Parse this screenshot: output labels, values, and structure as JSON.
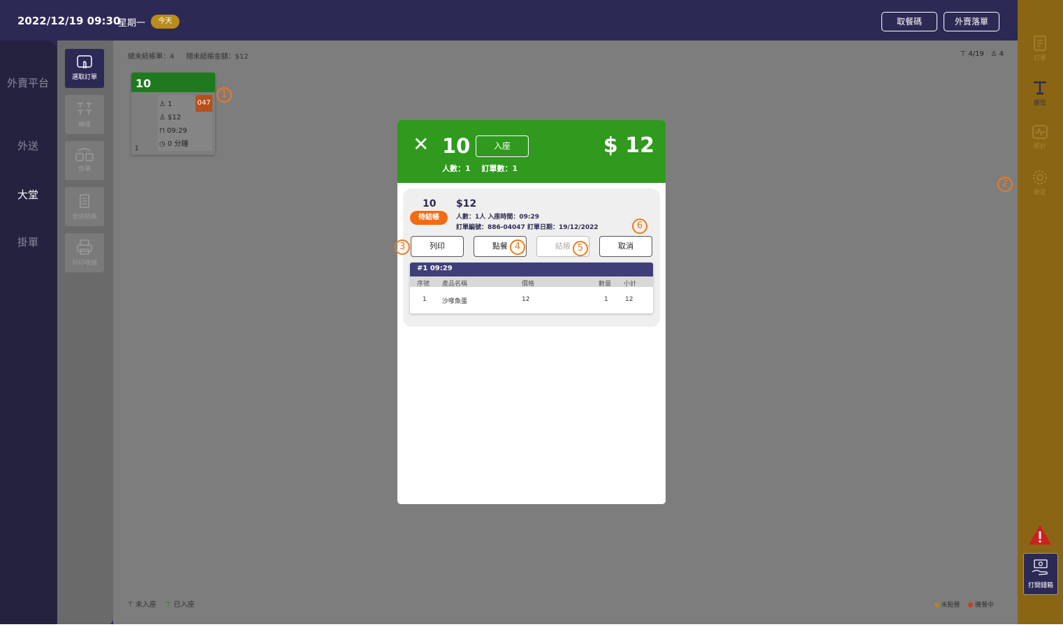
{
  "header": {
    "datetime": "2022/12/19 09:30",
    "weekday": "星期一",
    "today_badge": "今天",
    "pickup_code_button": "取餐碼",
    "takeout_order_button": "外賣落單"
  },
  "left_nav": {
    "items": [
      {
        "label": "外賣平台"
      },
      {
        "label": "外送"
      },
      {
        "label": "大堂"
      },
      {
        "label": "掛單"
      }
    ]
  },
  "tools": {
    "items": [
      {
        "label": "選取訂單",
        "icon": "touch-icon"
      },
      {
        "label": "轉檯",
        "icon": "swap-icon"
      },
      {
        "label": "併單",
        "icon": "merge-icon"
      },
      {
        "label": "合併結帳",
        "icon": "receipt-icon"
      },
      {
        "label": "列印收據",
        "icon": "printer-icon"
      }
    ]
  },
  "floor": {
    "unpaid_orders": "總未結帳單：4",
    "unpaid_amount": "總未結帳金額：$12",
    "table_count": "4/19",
    "people_count": "4",
    "legend_left": [
      "未入座",
      "已入座"
    ],
    "legend_right": [
      "未點餐",
      "備餐中"
    ]
  },
  "table_card": {
    "number": "10",
    "order_tag": "047",
    "people": "1",
    "amount": "$12",
    "time": "09:29",
    "duration": "0 分鐘",
    "footer": "1"
  },
  "right_nav": {
    "items": [
      {
        "label": "訂單",
        "icon": "document-icon"
      },
      {
        "label": "座位",
        "icon": "table-icon"
      },
      {
        "label": "統計",
        "icon": "chart-icon"
      },
      {
        "label": "設定",
        "icon": "gear-icon"
      }
    ],
    "cashbox_label": "打開錢箱"
  },
  "modal": {
    "table_number": "10",
    "seat_button": "入座",
    "total": "$ 12",
    "people_label": "人數：1",
    "order_count_label": "訂單數：1",
    "order": {
      "table": "10",
      "status": "待結帳",
      "amount": "$12",
      "info_line1": "人數：1人  入座時間：09:29",
      "info_line2": "訂單編號：886-04047  訂單日期：19/12/2022",
      "buttons": {
        "print": "列印",
        "order_food": "點餐",
        "checkout": "結帳",
        "cancel": "取消"
      },
      "batch_header": "#1  09:29",
      "columns": [
        "序號",
        "產品名稱",
        "價格",
        "數量",
        "小計"
      ],
      "rows": [
        {
          "seq": "1",
          "name": "沙嗲魚蛋",
          "price": "12",
          "qty": "1",
          "subtotal": "12"
        }
      ]
    }
  },
  "markers": [
    "1",
    "2",
    "3",
    "4",
    "5",
    "6"
  ],
  "colors": {
    "navy": "#2c2a55",
    "header_green": "#2f9a1d",
    "table_green": "#1f7a1f",
    "status_orange": "#f26b12",
    "marker_orange": "#f07a1a",
    "gold": "#8a6614"
  }
}
